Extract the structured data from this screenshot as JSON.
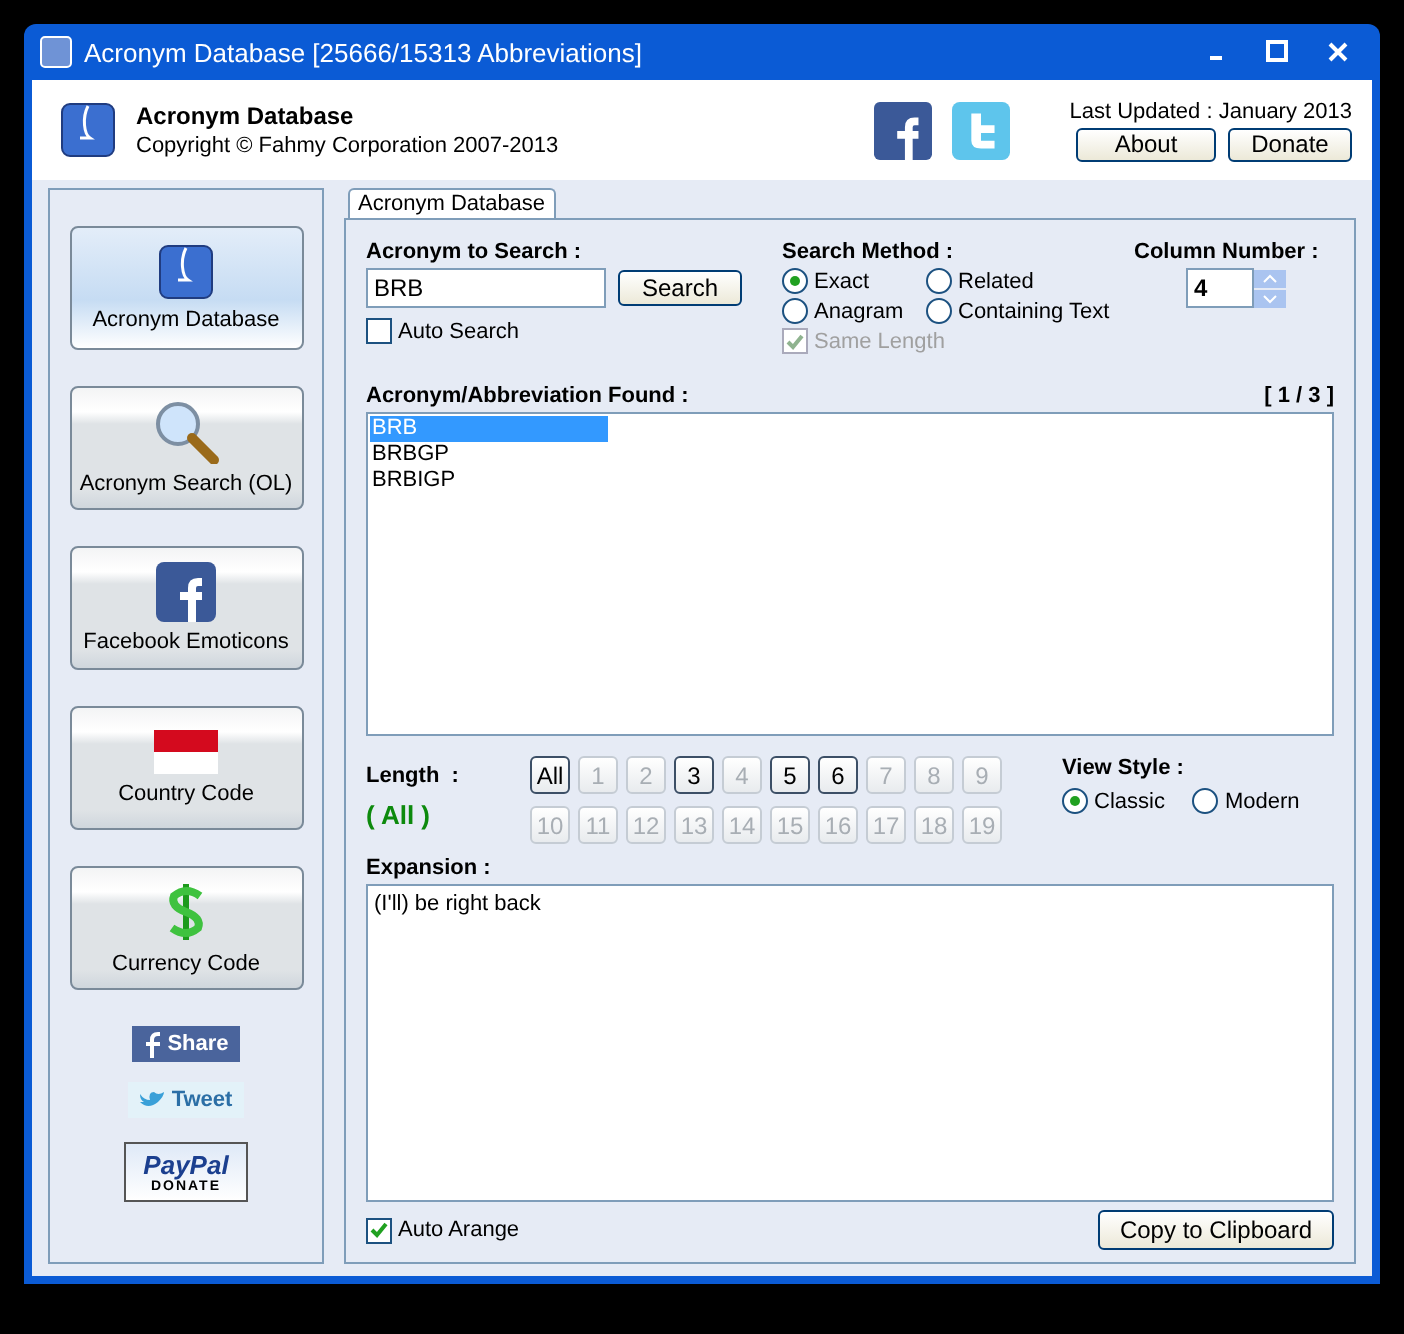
{
  "window": {
    "title": "Acronym Database [25666/15313 Abbreviations]"
  },
  "header": {
    "app_name": "Acronym Database",
    "copyright": "Copyright © Fahmy Corporation 2007-2013",
    "last_updated": "Last Updated : January 2013",
    "buttons": [
      "About",
      "Donate"
    ]
  },
  "sidebar": {
    "items": [
      {
        "label": "Acronym Database",
        "kind": "app",
        "selected": true
      },
      {
        "label": "Acronym Search (OL)",
        "kind": "search",
        "selected": false
      },
      {
        "label": "Facebook Emoticons",
        "kind": "facebook",
        "selected": false
      },
      {
        "label": "Country Code",
        "kind": "flag",
        "selected": false
      },
      {
        "label": "Currency Code",
        "kind": "dollar",
        "selected": false
      }
    ],
    "share_buttons": [
      {
        "label": "Share",
        "kind": "facebook"
      },
      {
        "label": "Tweet",
        "kind": "twitter"
      }
    ],
    "paypal": {
      "label": "PayPal",
      "sub": "DONATE"
    }
  },
  "tabs": [
    {
      "label": "Acronym Database",
      "selected": true
    }
  ],
  "search": {
    "label": "Acronym to Search :",
    "value": "BRB",
    "button": "Search",
    "auto_search": {
      "label": "Auto Search",
      "checked": false
    }
  },
  "search_method": {
    "label": "Search Method :",
    "options": [
      {
        "label": "Exact",
        "selected": true
      },
      {
        "label": "Related",
        "selected": false
      },
      {
        "label": "Anagram",
        "selected": false
      },
      {
        "label": "Containing Text",
        "selected": false
      }
    ],
    "same_length": {
      "label": "Same Length",
      "checked": true,
      "disabled": true
    }
  },
  "column_number": {
    "label": "Column Number :",
    "value": "4"
  },
  "results": {
    "label": "Acronym/Abbreviation Found :",
    "counter": "[ 1 / 3 ]",
    "items": [
      {
        "text": "BRB",
        "selected": true
      },
      {
        "text": "BRBGP",
        "selected": false
      },
      {
        "text": "BRBIGP",
        "selected": false
      }
    ]
  },
  "length": {
    "label": "Length  :",
    "current": "( All )",
    "buttons": [
      {
        "label": "All",
        "enabled": true
      },
      {
        "label": "1",
        "enabled": false
      },
      {
        "label": "2",
        "enabled": false
      },
      {
        "label": "3",
        "enabled": true
      },
      {
        "label": "4",
        "enabled": false
      },
      {
        "label": "5",
        "enabled": true
      },
      {
        "label": "6",
        "enabled": true
      },
      {
        "label": "7",
        "enabled": false
      },
      {
        "label": "8",
        "enabled": false
      },
      {
        "label": "9",
        "enabled": false
      },
      {
        "label": "10",
        "enabled": false
      },
      {
        "label": "11",
        "enabled": false
      },
      {
        "label": "12",
        "enabled": false
      },
      {
        "label": "13",
        "enabled": false
      },
      {
        "label": "14",
        "enabled": false
      },
      {
        "label": "15",
        "enabled": false
      },
      {
        "label": "16",
        "enabled": false
      },
      {
        "label": "17",
        "enabled": false
      },
      {
        "label": "18",
        "enabled": false
      },
      {
        "label": "19",
        "enabled": false
      }
    ]
  },
  "view_style": {
    "label": "View Style :",
    "options": [
      {
        "label": "Classic",
        "selected": true
      },
      {
        "label": "Modern",
        "selected": false
      }
    ]
  },
  "expansion": {
    "label": "Expansion :",
    "text": "(I'll) be right back"
  },
  "auto_arrange": {
    "label": "Auto Arange",
    "checked": true
  },
  "copy_button": "Copy to Clipboard"
}
